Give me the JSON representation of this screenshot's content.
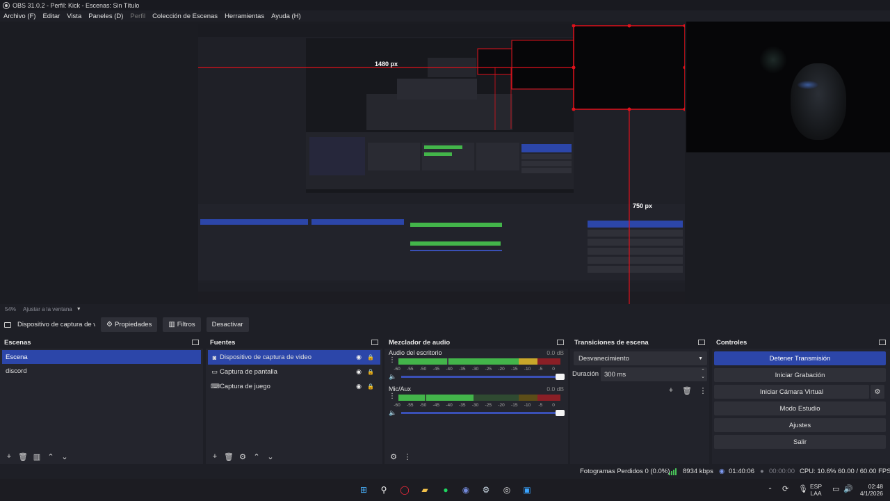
{
  "window": {
    "title": "OBS 31.0.2 - Perfil: Kick - Escenas: Sin Título"
  },
  "menu": [
    {
      "label": "Archivo (F)",
      "enabled": true
    },
    {
      "label": "Editar",
      "enabled": true
    },
    {
      "label": "Vista",
      "enabled": true
    },
    {
      "label": "Paneles (D)",
      "enabled": true
    },
    {
      "label": "Perfil",
      "enabled": false
    },
    {
      "label": "Colección de Escenas",
      "enabled": true
    },
    {
      "label": "Herramientas",
      "enabled": true
    },
    {
      "label": "Ayuda (H)",
      "enabled": true
    }
  ],
  "preview": {
    "nested_labels": {
      "width_label": "1480 px",
      "height_label": "750 px"
    },
    "zoom": "54%",
    "zoom_mode": "Ajustar a la ventana"
  },
  "source_toolbar": {
    "source_name": "Dispositivo de captura de v",
    "properties": "Propiedades",
    "filters": "Filtros",
    "deactivate": "Desactivar"
  },
  "scenes": {
    "title": "Escenas",
    "items": [
      {
        "label": "Escena",
        "selected": true
      },
      {
        "label": "discord",
        "selected": false
      }
    ]
  },
  "sources": {
    "title": "Fuentes",
    "items": [
      {
        "label": "Dispositivo de captura de video",
        "icon": "camera-icon",
        "selected": true
      },
      {
        "label": "Captura de pantalla",
        "icon": "monitor-icon",
        "selected": false
      },
      {
        "label": "Captura de juego",
        "icon": "gamepad-icon",
        "selected": false
      }
    ]
  },
  "mixer": {
    "title": "Mezclador de audio",
    "channels": [
      {
        "name": "Audio del escritorio",
        "db": "0.0 dB",
        "level": 0.85
      },
      {
        "name": "Mic/Aux",
        "db": "0.0 dB",
        "level": 0.46
      }
    ],
    "ticks": [
      "-60",
      "-55",
      "-50",
      "-45",
      "-40",
      "-35",
      "-30",
      "-25",
      "-20",
      "-15",
      "-10",
      "-5",
      "0"
    ]
  },
  "transitions": {
    "title": "Transiciones de escena",
    "selected": "Desvanecimiento",
    "duration_label": "Duración",
    "duration_value": "300 ms"
  },
  "controls": {
    "title": "Controles",
    "stop_stream": "Detener Transmisión",
    "start_recording": "Iniciar Grabación",
    "start_virtual_cam": "Iniciar Cámara Virtual",
    "studio_mode": "Modo Estudio",
    "settings": "Ajustes",
    "exit": "Salir"
  },
  "status": {
    "dropped_frames": "Fotogramas Perdidos 0 (0.0%)",
    "bitrate": "8934 kbps",
    "stream_time": "01:40:06",
    "rec_time": "00:00:00",
    "cpu": "CPU: 10.6%",
    "fps": "60.00 / 60.00 FPS"
  },
  "taskbar": {
    "lang_top": "ESP",
    "lang_bottom": "LAA",
    "time": "02:48",
    "date": "4/1/2026"
  },
  "colors": {
    "accent": "#2c46a9",
    "meter_green": "#43b54a",
    "meter_yellow": "#c9a72a",
    "meter_red": "#8a1f26",
    "overlay_red": "#e0111b"
  }
}
